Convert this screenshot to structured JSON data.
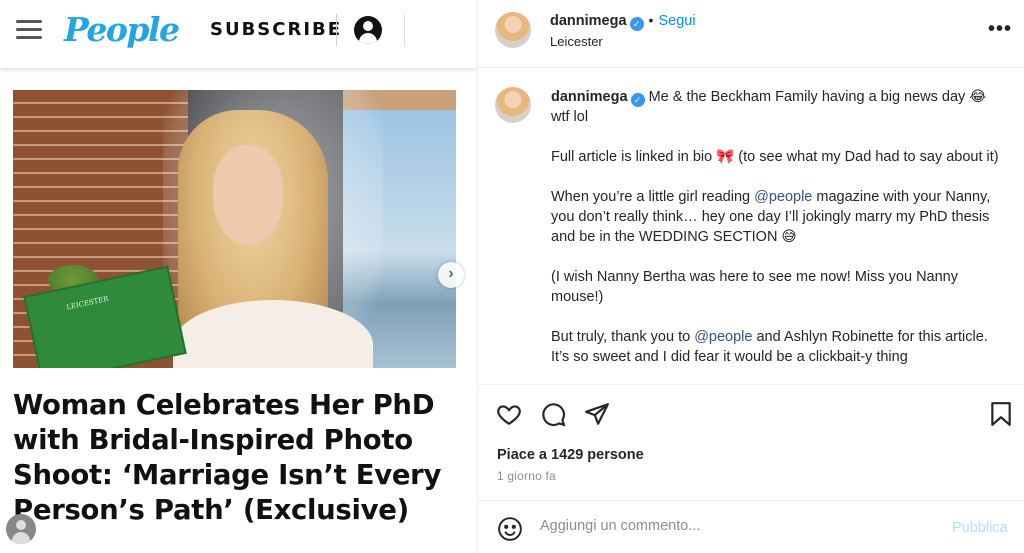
{
  "people_site": {
    "logo": "People",
    "subscribe_label": "SUBSCRIBE",
    "headline": "Woman Celebrates Her PhD with Bridal-Inspired Photo Shoot: ‘Marriage Isn’t Every Person’s Path’ (Exclusive)",
    "thesis_label": "LEICESTER",
    "carousel_next": "›"
  },
  "instagram": {
    "header": {
      "username": "dannimega",
      "verified_mark": "✓",
      "separator": "•",
      "follow_label": "Segui",
      "location": "Leicester",
      "more_icon": "•••"
    },
    "caption": {
      "username": "dannimega",
      "verified_mark": "✓",
      "p1_text": " Me & the Beckham Family having a big news day ",
      "p1_emoji": "😂",
      "p1_tail": " wtf lol",
      "p2_text": "Full article is linked in bio ",
      "p2_emoji": "🎀",
      "p2_tail": " (to see what my Dad had to say about it)",
      "p3_a": "When you’re a little girl reading ",
      "p3_mention": "@people",
      "p3_b": " magazine with your Nanny, you don’t really think… hey one day I’ll jokingly marry my PhD thesis and be in the WEDDING SECTION ",
      "p3_emoji": "😅",
      "p4": "(I wish Nanny Bertha was here to see me now! Miss you Nanny mouse!)",
      "p5_a": "But truly, thank you to ",
      "p5_mention": "@people",
      "p5_b": " and Ashlyn Robinette for this article. It’s so sweet and I did fear it would be a clickbait-y thing"
    },
    "likes": "Piace a 1429 persone",
    "time": "1 giorno fa",
    "comment": {
      "placeholder": "Aggiungi un commento...",
      "publish_label": "Pubblica"
    },
    "colors": {
      "link_blue": "#0095f6",
      "mention_blue": "#385185",
      "publish_disabled": "#b2dffc",
      "people_brand": "#22a6e0"
    }
  }
}
